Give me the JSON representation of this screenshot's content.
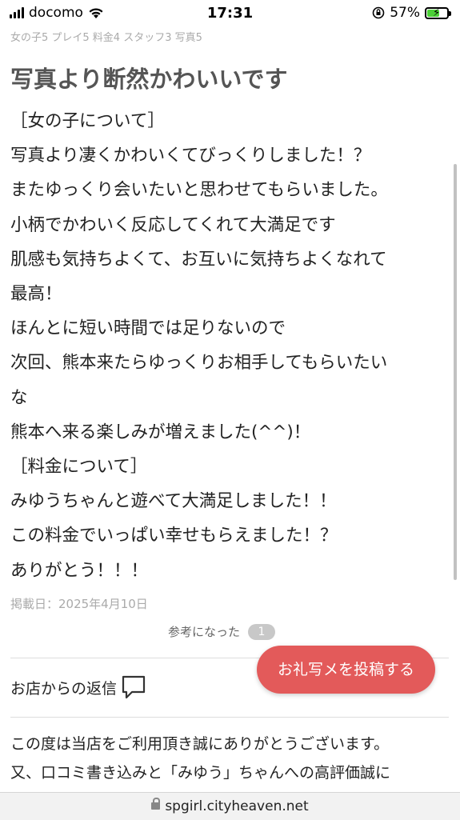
{
  "status_bar": {
    "carrier": "docomo",
    "time": "17:31",
    "battery": "57%"
  },
  "review": {
    "scores": "女の子5 プレイ5 料金4 スタッフ3 写真5",
    "title": "写真より断然かわいいです",
    "lines": [
      "［女の子について］",
      "写真より凄くかわいくてびっくりしました！？",
      "またゆっくり会いたいと思わせてもらいました。",
      "小柄でかわいく反応してくれて大満足です",
      "肌感も気持ちよくて、お互いに気持ちよくなれて",
      "最高！",
      "ほんとに短い時間では足りないので",
      "次回、熊本来たらゆっくりお相手してもらいたい",
      "な",
      "熊本へ来る楽しみが増えました(^^)！",
      "［料金について］",
      "みゆうちゃんと遊べて大満足しました！！",
      "この料金でいっぱい幸せもらえました！？",
      "ありがとう！！！"
    ],
    "posted_date": "掲載日：2025年4月10日",
    "helpful_label": "参考になった",
    "helpful_count": "1"
  },
  "shop_reply": {
    "label": "お店からの返信",
    "icon": "chat-bubble-icon",
    "lines": [
      "この度は当店をご利用頂き誠にありがとうございます。",
      "又、口コミ書き込みと「みゆう」ちゃんへの高評価誠に"
    ]
  },
  "cta": {
    "label": "お礼写メを投稿する",
    "color": "#e35a5a"
  },
  "url_bar": {
    "domain": "spgirl.cityheaven.net"
  }
}
